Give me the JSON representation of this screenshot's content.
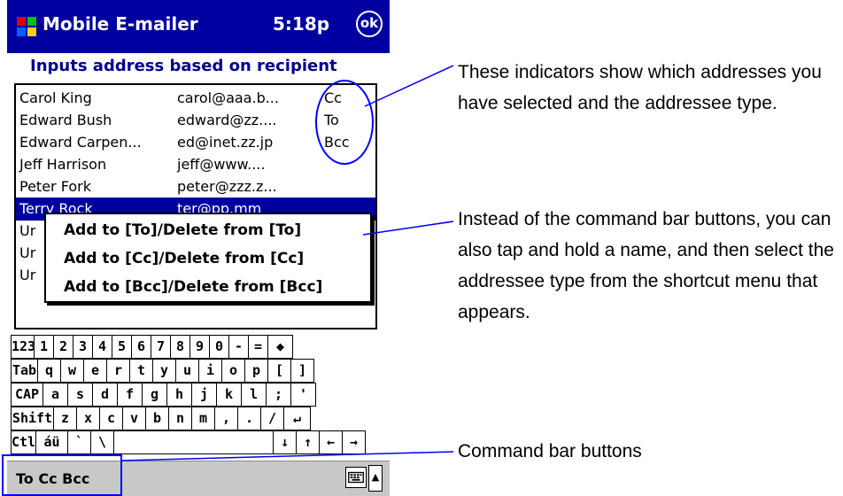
{
  "titlebar": {
    "app_title": "Mobile E-mailer",
    "clock": "5:18p",
    "ok": "ok"
  },
  "subtitle": "Inputs address based on recipient",
  "contacts": [
    {
      "name": "Carol King",
      "email": "carol@aaa.b...",
      "type": "Cc"
    },
    {
      "name": "Edward Bush",
      "email": "edward@zz....",
      "type": "To"
    },
    {
      "name": "Edward Carpen...",
      "email": "ed@inet.zz.jp",
      "type": "Bcc"
    },
    {
      "name": "Jeff Harrison",
      "email": "jeff@www....",
      "type": ""
    },
    {
      "name": "Peter Fork",
      "email": "peter@zzz.z...",
      "type": ""
    },
    {
      "name": "Terry Rock",
      "email": "ter@pp.mm",
      "type": ""
    },
    {
      "name": "Ur",
      "email": "",
      "type": ""
    },
    {
      "name": "Ur",
      "email": "",
      "type": ""
    },
    {
      "name": "Ur",
      "email": "",
      "type": ""
    }
  ],
  "context_menu": [
    "Add to [To]/Delete from [To]",
    "Add to [Cc]/Delete from [Cc]",
    "Add to [Bcc]/Delete from [Bcc]"
  ],
  "keyboard": {
    "row1": [
      "123",
      "1",
      "2",
      "3",
      "4",
      "5",
      "6",
      "7",
      "8",
      "9",
      "0",
      "-",
      "=",
      "◆"
    ],
    "row2": [
      "Tab",
      "q",
      "w",
      "e",
      "r",
      "t",
      "y",
      "u",
      "i",
      "o",
      "p",
      "[",
      "]"
    ],
    "row3": [
      "CAP",
      "a",
      "s",
      "d",
      "f",
      "g",
      "h",
      "j",
      "k",
      "l",
      ";",
      "'"
    ],
    "row4": [
      "Shift",
      "z",
      "x",
      "c",
      "v",
      "b",
      "n",
      "m",
      ",",
      ".",
      "/",
      "↵"
    ],
    "row5": [
      "Ctl",
      "áü",
      "`",
      "\\",
      "",
      "↓",
      "↑",
      "←",
      "→"
    ]
  },
  "command_bar": {
    "buttons": "To Cc Bcc",
    "keyboard_icon": "keyboard-icon",
    "sip_arrow": "▲"
  },
  "annotations": {
    "indicators": "These indicators show which addresses you have selected and the addressee type.",
    "shortcut": "Instead of the command bar buttons, you can also tap and hold a name, and then select the addressee type from the shortcut menu that appears.",
    "command_bar": "Command bar buttons"
  },
  "colors": {
    "titlebar": "#0000a0",
    "accent": "#0000ff",
    "selection": "#0000a0",
    "command_bar": "#c8c8c8"
  }
}
